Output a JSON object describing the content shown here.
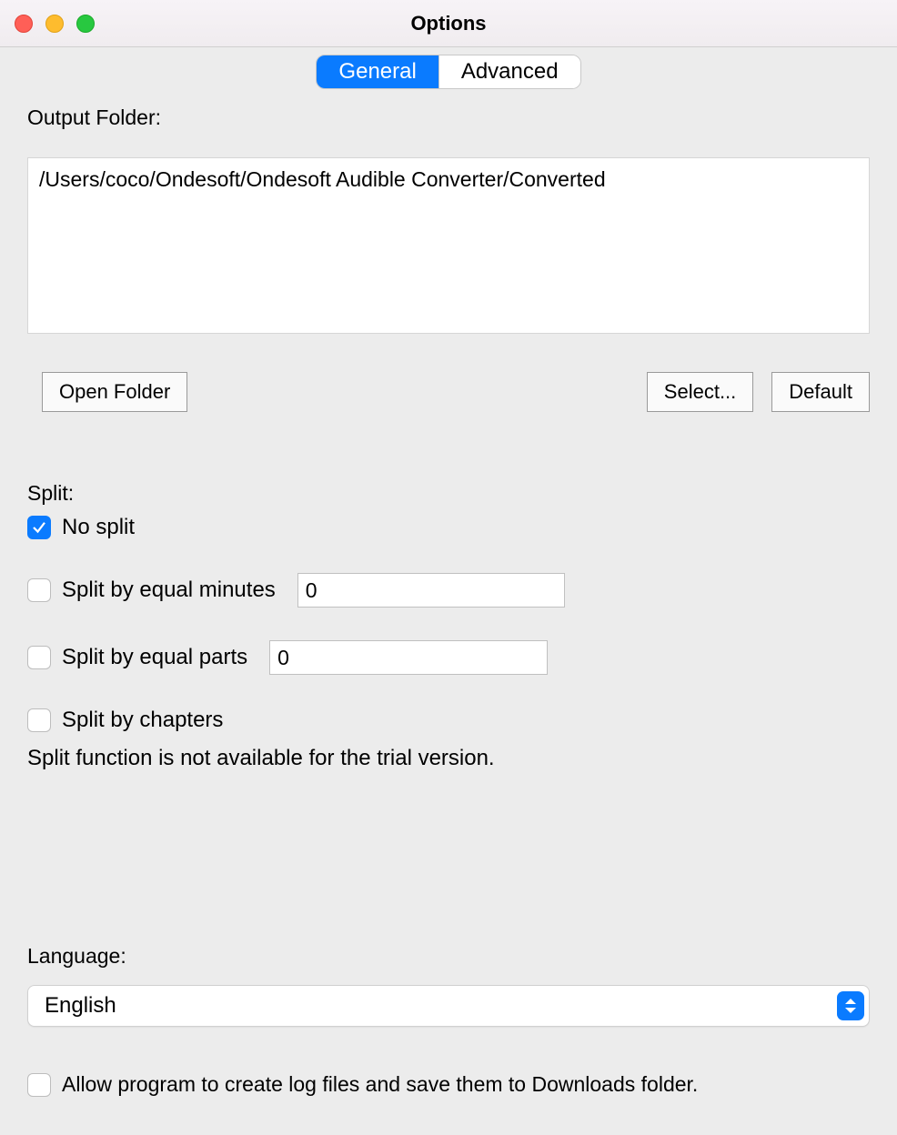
{
  "window": {
    "title": "Options"
  },
  "tabs": {
    "general": "General",
    "advanced": "Advanced",
    "active": "general"
  },
  "outputFolder": {
    "label": "Output Folder:",
    "path": "/Users/coco/Ondesoft/Ondesoft Audible Converter/Converted"
  },
  "buttons": {
    "openFolder": "Open Folder",
    "select": "Select...",
    "default": "Default"
  },
  "split": {
    "label": "Split:",
    "noSplit": {
      "label": "No split",
      "checked": true
    },
    "byMinutes": {
      "label": "Split by equal minutes",
      "checked": false,
      "value": "0"
    },
    "byParts": {
      "label": "Split by equal parts",
      "checked": false,
      "value": "0"
    },
    "byChapters": {
      "label": "Split by chapters",
      "checked": false
    },
    "trialNote": "Split function is not available for the trial version."
  },
  "language": {
    "label": "Language:",
    "selected": "English"
  },
  "log": {
    "label": "Allow program to create log files and save them to Downloads folder.",
    "checked": false
  }
}
